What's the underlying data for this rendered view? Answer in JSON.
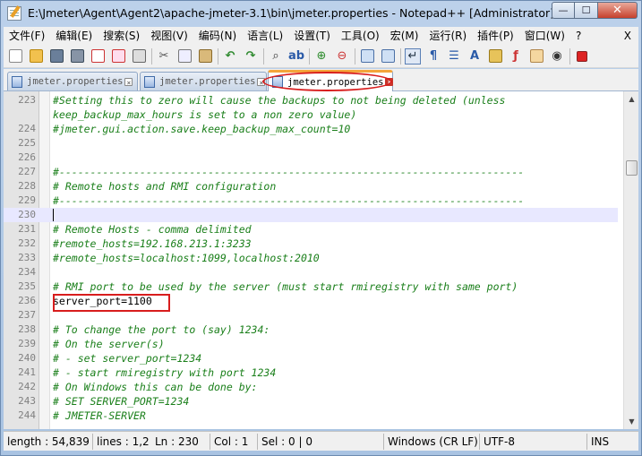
{
  "window": {
    "title": "E:\\Jmeter\\Agent\\Agent2\\apache-jmeter-3.1\\bin\\jmeter.properties - Notepad++ [Administrator]",
    "minimize": "—",
    "maximize": "☐",
    "close": "✕"
  },
  "menu": {
    "items": [
      "文件(F)",
      "编辑(E)",
      "搜索(S)",
      "视图(V)",
      "编码(N)",
      "语言(L)",
      "设置(T)",
      "工具(O)",
      "宏(M)",
      "运行(R)",
      "插件(P)",
      "窗口(W)",
      "?"
    ],
    "close": "X"
  },
  "toolbar": {
    "icons": [
      "new-file-icon",
      "open-file-icon",
      "save-icon",
      "save-all-icon",
      "close-file-icon",
      "close-all-icon",
      "print-icon",
      "cut-icon",
      "copy-icon",
      "paste-icon",
      "undo-icon",
      "redo-icon",
      "find-icon",
      "replace-icon",
      "zoom-in-icon",
      "zoom-out-icon",
      "sync-vertical-icon",
      "sync-horizontal-icon",
      "word-wrap-icon",
      "show-all-chars-icon",
      "indent-guide-icon",
      "language-icon",
      "function-list-icon",
      "document-map-icon",
      "folder-icon",
      "monitoring-icon",
      "record-macro-icon"
    ]
  },
  "tabs": [
    {
      "label": "jmeter.properties",
      "active": false
    },
    {
      "label": "jmeter.properties",
      "active": false
    },
    {
      "label": "jmeter.properties",
      "active": true
    }
  ],
  "editor": {
    "current_line": 230,
    "lines": [
      {
        "n": "223",
        "text": "#Setting this to zero will cause the backups to not being deleted (unless",
        "kind": "comment"
      },
      {
        "n": "",
        "text": "keep_backup_max_hours is set to a non zero value)",
        "kind": "comment"
      },
      {
        "n": "224",
        "text": "#jmeter.gui.action.save.keep_backup_max_count=10",
        "kind": "comment"
      },
      {
        "n": "225",
        "text": "",
        "kind": "plain"
      },
      {
        "n": "226",
        "text": "",
        "kind": "plain"
      },
      {
        "n": "227",
        "text": "#---------------------------------------------------------------------------",
        "kind": "comment"
      },
      {
        "n": "228",
        "text": "# Remote hosts and RMI configuration",
        "kind": "comment"
      },
      {
        "n": "229",
        "text": "#---------------------------------------------------------------------------",
        "kind": "comment"
      },
      {
        "n": "230",
        "text": "",
        "kind": "plain"
      },
      {
        "n": "231",
        "text": "# Remote Hosts - comma delimited",
        "kind": "comment"
      },
      {
        "n": "232",
        "text": "#remote_hosts=192.168.213.1:3233",
        "kind": "comment"
      },
      {
        "n": "233",
        "text": "#remote_hosts=localhost:1099,localhost:2010",
        "kind": "comment"
      },
      {
        "n": "234",
        "text": "",
        "kind": "plain"
      },
      {
        "n": "235",
        "text": "# RMI port to be used by the server (must start rmiregistry with same port)",
        "kind": "comment"
      },
      {
        "n": "236",
        "text": "server_port=1100",
        "kind": "plain"
      },
      {
        "n": "237",
        "text": "",
        "kind": "plain"
      },
      {
        "n": "238",
        "text": "# To change the port to (say) 1234:",
        "kind": "comment"
      },
      {
        "n": "239",
        "text": "# On the server(s)",
        "kind": "comment"
      },
      {
        "n": "240",
        "text": "# - set server_port=1234",
        "kind": "comment"
      },
      {
        "n": "241",
        "text": "# - start rmiregistry with port 1234",
        "kind": "comment"
      },
      {
        "n": "242",
        "text": "# On Windows this can be done by:",
        "kind": "comment"
      },
      {
        "n": "243",
        "text": "# SET SERVER_PORT=1234",
        "kind": "comment"
      },
      {
        "n": "244",
        "text": "# JMETER-SERVER",
        "kind": "comment"
      }
    ]
  },
  "status": {
    "length": "length : 54,839",
    "lines": "lines : 1,2",
    "ln": "Ln : 230",
    "col": "Col : 1",
    "sel": "Sel : 0 | 0",
    "eol": "Windows (CR LF)",
    "encoding": "UTF-8",
    "mode": "INS"
  },
  "colors": {
    "comment": "#1a7f1a",
    "highlight_annotation": "#d81d1d",
    "current_line": "#e8e8ff",
    "active_tab_accent": "#f4a53a"
  }
}
